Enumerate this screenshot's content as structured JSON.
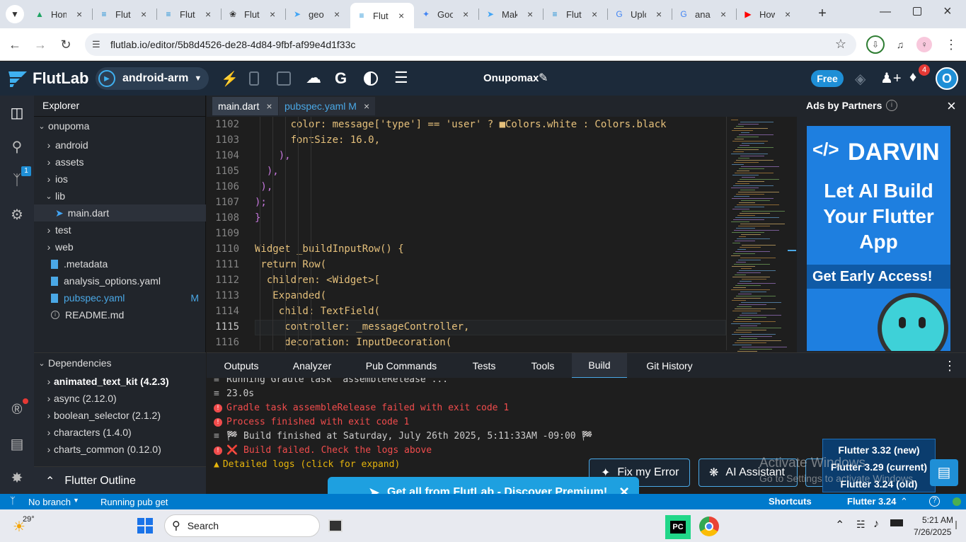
{
  "browser": {
    "tabs": [
      {
        "label": "Hom",
        "icon": "google-drive-icon"
      },
      {
        "label": "Flut",
        "icon": "flutlab-icon"
      },
      {
        "label": "Flut",
        "icon": "flutlab-icon"
      },
      {
        "label": "Flut",
        "icon": "chatgpt-icon"
      },
      {
        "label": "geo",
        "icon": "flutter-icon"
      },
      {
        "label": "Flut",
        "icon": "flutlab-icon"
      },
      {
        "label": "Goo",
        "icon": "gemini-icon"
      },
      {
        "label": "Mak",
        "icon": "flutter-icon"
      },
      {
        "label": "Flut",
        "icon": "flutlab-icon"
      },
      {
        "label": "Uplo",
        "icon": "google-icon"
      },
      {
        "label": "anal",
        "icon": "google-icon"
      },
      {
        "label": "How",
        "icon": "youtube-icon"
      }
    ],
    "url": "flutlab.io/editor/5b8d4526-de28-4d84-9fbf-af99e4d1f33c"
  },
  "header": {
    "brand": "FlutLab",
    "target": "android-arm",
    "project": "Onupomax",
    "plan": "Free",
    "notif_count": "4",
    "avatar": "O"
  },
  "sidebar": {
    "git_badge": "1"
  },
  "explorer": {
    "title": "Explorer",
    "root": "onupoma",
    "items": [
      {
        "label": "android",
        "type": "folder"
      },
      {
        "label": "assets",
        "type": "folder"
      },
      {
        "label": "ios",
        "type": "folder"
      },
      {
        "label": "lib",
        "type": "folder-open"
      },
      {
        "label": "main.dart",
        "type": "dart"
      },
      {
        "label": "test",
        "type": "folder"
      },
      {
        "label": "web",
        "type": "folder"
      },
      {
        "label": ".metadata",
        "type": "file"
      },
      {
        "label": "analysis_options.yaml",
        "type": "file"
      },
      {
        "label": "pubspec.yaml",
        "type": "file-mod"
      },
      {
        "label": "README.md",
        "type": "info"
      }
    ],
    "modified_flag": "M"
  },
  "dependencies": {
    "title": "Dependencies",
    "items": [
      "animated_text_kit (4.2.3)",
      "async (2.12.0)",
      "boolean_selector (2.1.2)",
      "characters (1.4.0)",
      "charts_common (0.12.0)"
    ],
    "outline": "Flutter Outline"
  },
  "editor": {
    "tabs": [
      {
        "label": "main.dart"
      },
      {
        "label": "pubspec.yaml M"
      }
    ],
    "lines": [
      {
        "n": "1102",
        "code": "      color: message['type'] == 'user' ? ■Colors.white : Colors.black"
      },
      {
        "n": "1103",
        "code": "      fontSize: 16.0,"
      },
      {
        "n": "1104",
        "code": "    ),"
      },
      {
        "n": "1105",
        "code": "  ),"
      },
      {
        "n": "1106",
        "code": " ),"
      },
      {
        "n": "1107",
        "code": ");"
      },
      {
        "n": "1108",
        "code": "}"
      },
      {
        "n": "1109",
        "code": ""
      },
      {
        "n": "1110",
        "code": "Widget _buildInputRow() {"
      },
      {
        "n": "1111",
        "code": " return Row("
      },
      {
        "n": "1112",
        "code": "  children: <Widget>["
      },
      {
        "n": "1113",
        "code": "   Expanded("
      },
      {
        "n": "1114",
        "code": "    child: TextField("
      },
      {
        "n": "1115",
        "code": "     controller: _messageController,"
      },
      {
        "n": "1116",
        "code": "     decoration: InputDecoration("
      }
    ]
  },
  "ads": {
    "title": "Ads by Partners",
    "brand": "DARVIN",
    "headline": "Let AI Build Your Flutter App",
    "cta": "Get Early Access!"
  },
  "panel": {
    "tabs": [
      "Outputs",
      "Analyzer",
      "Pub Commands",
      "Tests",
      "Tools",
      "Build",
      "Git History"
    ],
    "active": "Build",
    "log": [
      {
        "type": "info",
        "text": "Running Gradle task 'assembleRelease'..."
      },
      {
        "type": "info",
        "text": "23.0s"
      },
      {
        "type": "error",
        "text": "Gradle task assembleRelease failed with exit code 1"
      },
      {
        "type": "error",
        "text": "Process finished with exit code 1"
      },
      {
        "type": "info",
        "text": "🏁 Build finished at Saturday, July 26th 2025, 5:11:33AM -09:00 🏁"
      },
      {
        "type": "error",
        "text": "❌ Build failed. Check the logs above"
      },
      {
        "type": "warn",
        "text": "Detailed logs (click for expand)"
      }
    ],
    "fix_button": "Fix my Error",
    "ai_button": "AI Assistant"
  },
  "versions": {
    "items": [
      "Flutter 3.32 (new)",
      "Flutter 3.29 (current)",
      "Flutter 3.24 (old)"
    ]
  },
  "watermark": {
    "line1": "Activate Windows",
    "line2": "Go to Settings to activate Windows."
  },
  "promo": {
    "text": "Get all from FlutLab - Discover Premium!"
  },
  "status": {
    "branch": "No branch",
    "task": "Running pub get",
    "shortcuts": "Shortcuts",
    "flutter": "Flutter 3.24"
  },
  "taskbar": {
    "temp": "29°",
    "search": "Search",
    "time": "5:21 AM",
    "date": "7/26/2025"
  },
  "colors": {
    "accent": "#0b8fd8",
    "error": "#f14c4c",
    "warn": "#e5b40b"
  }
}
